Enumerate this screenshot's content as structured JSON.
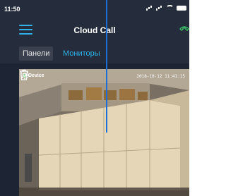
{
  "status_bar": {
    "time": "11:50"
  },
  "app_bar": {
    "title": "Cloud Call"
  },
  "tabs": [
    {
      "label": "Панели",
      "active": true
    },
    {
      "label": "Мониторы",
      "active": false
    }
  ],
  "camera": {
    "device_name": "Device",
    "timestamp": "2018-10-12 11:41:15",
    "online": true
  },
  "icons": {
    "menu": "hamburger-menu-icon",
    "app_bar_right": "phone-icon",
    "settings": "gear-icon",
    "delete": "trash-icon"
  },
  "colors": {
    "accent": "#2fb2e8",
    "app_bar": "#252c3b",
    "background": "#1d2433",
    "online": "#4fd24f"
  }
}
